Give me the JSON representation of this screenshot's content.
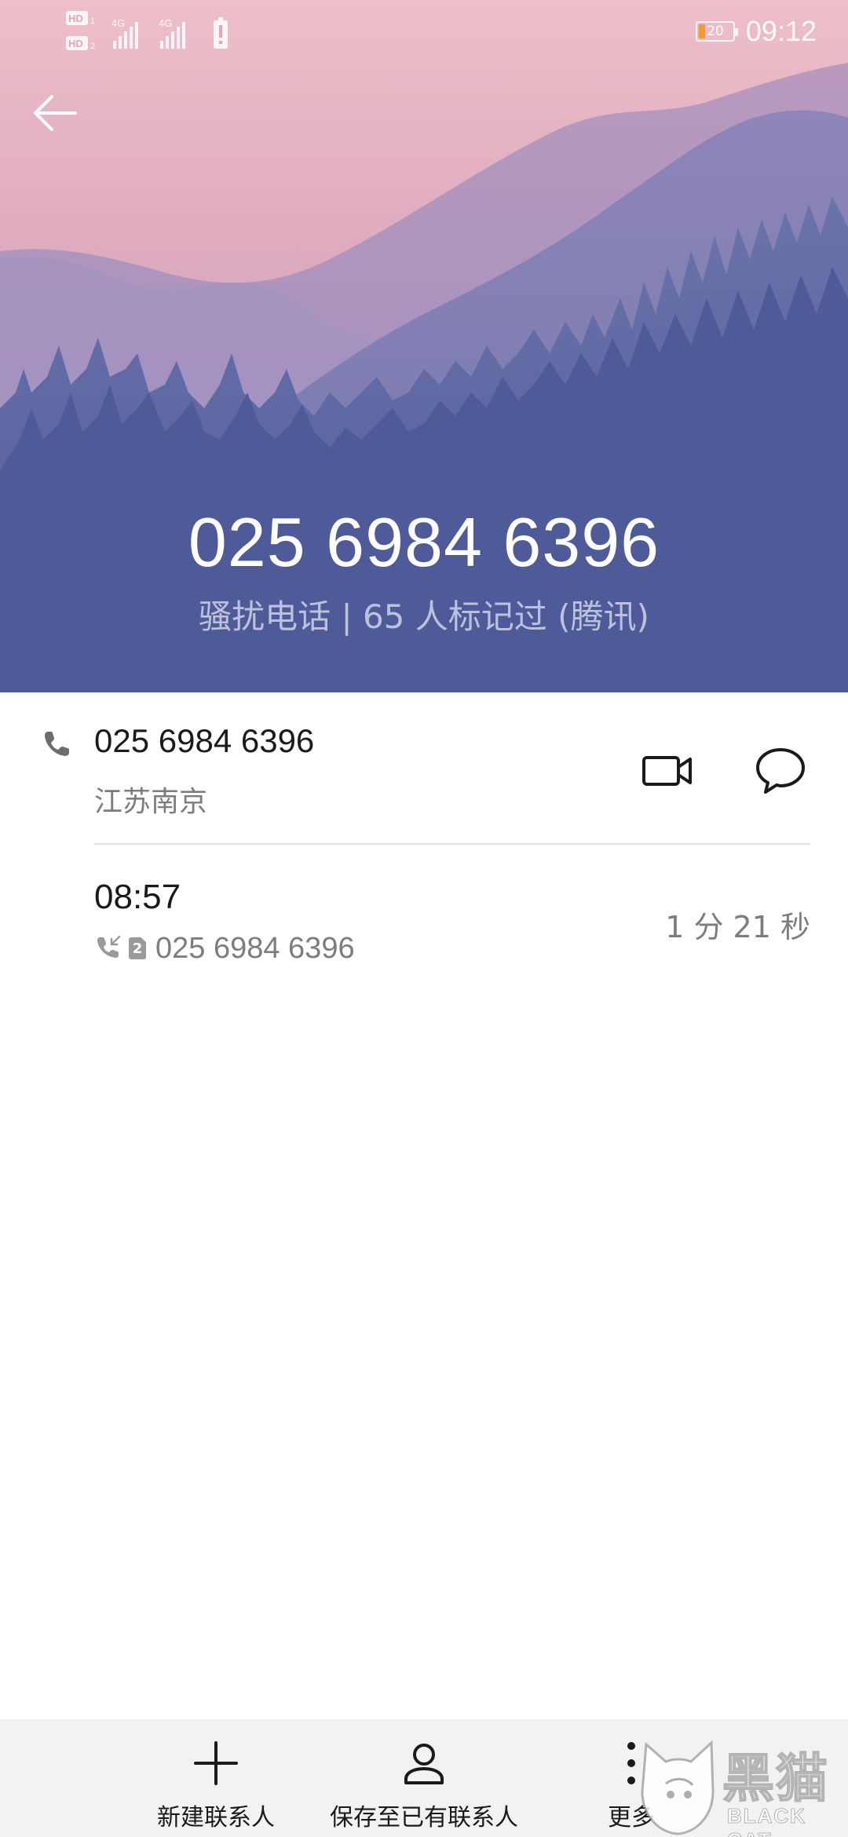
{
  "status_bar": {
    "network_1": "4G",
    "network_2": "4G",
    "battery_level": "20",
    "time": "09:12"
  },
  "header": {
    "phone_number": "025 6984 6396",
    "tag_line": "骚扰电话 | 65 人标记过 (腾讯)"
  },
  "number_row": {
    "number": "025 6984 6396",
    "location": "江苏南京"
  },
  "call_log": [
    {
      "time": "08:57",
      "sim": "2",
      "number": "025 6984 6396",
      "duration": "1 分 21 秒"
    }
  ],
  "bottom_bar": {
    "new_contact_label": "新建联系人",
    "save_existing_label": "保存至已有联系人",
    "more_label": "更多"
  },
  "watermark": {
    "cn": "黑猫",
    "en": "BLACK CAT"
  },
  "icons": {
    "back": "arrow-left-icon",
    "phone": "phone-icon",
    "video": "video-call-icon",
    "message": "message-bubble-icon",
    "incoming": "incoming-call-icon",
    "add": "plus-icon",
    "person": "person-icon",
    "more": "more-vertical-icon"
  },
  "colors": {
    "header_top": "#e9b9c4",
    "header_bottom": "#4c5796",
    "battery_accent": "#f39a2a",
    "bottom_bar_bg": "#f2f2f2"
  }
}
